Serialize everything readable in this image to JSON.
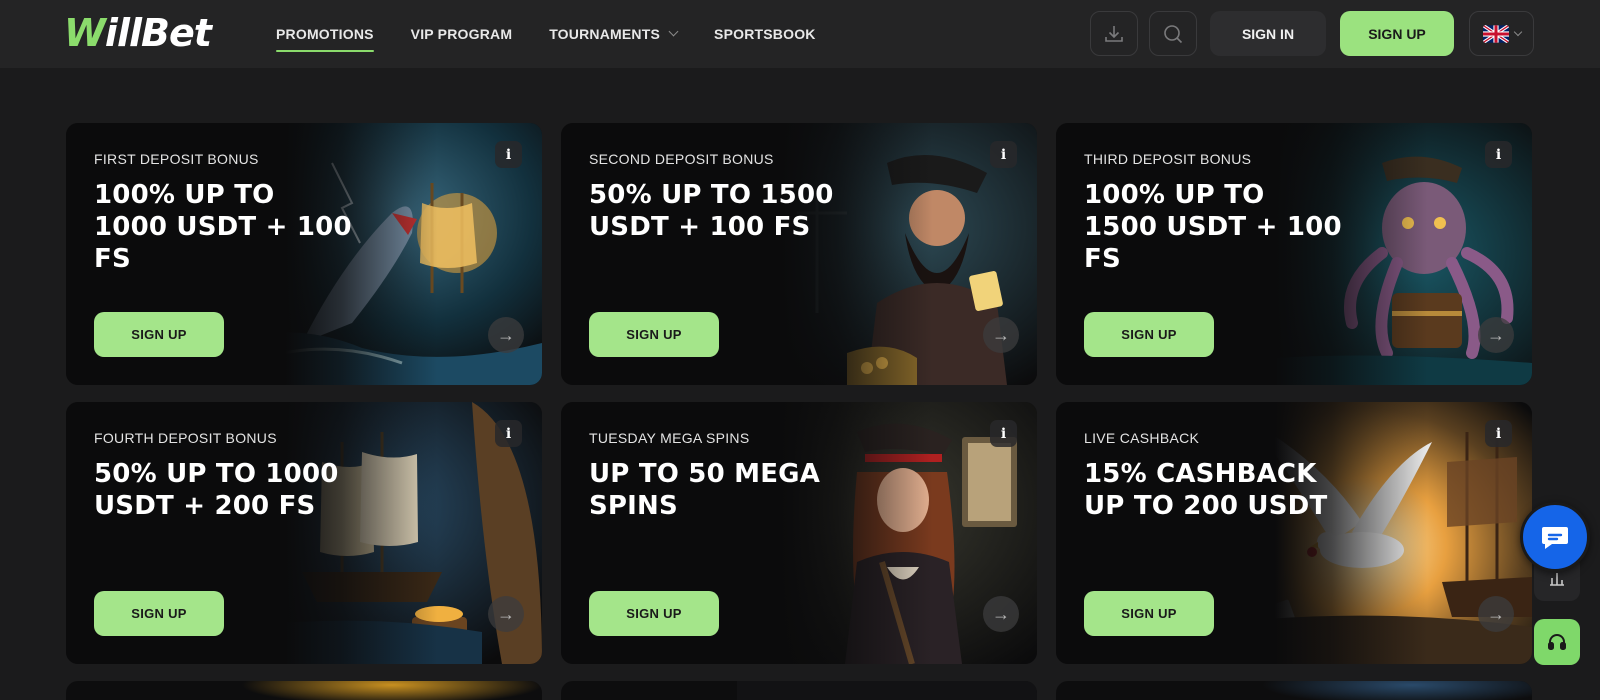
{
  "header": {
    "logo": {
      "w": "W",
      "rest": "illBet"
    },
    "nav": [
      {
        "label": "PROMOTIONS",
        "active": true
      },
      {
        "label": "VIP PROGRAM"
      },
      {
        "label": "TOURNAMENTS",
        "dropdown": true
      },
      {
        "label": "SPORTSBOOK"
      }
    ],
    "download_icon": "download-icon",
    "search_icon": "search-icon",
    "sign_in": "SIGN IN",
    "sign_up": "SIGN UP",
    "language_flag": "uk-flag-icon"
  },
  "colors": {
    "accent": "#9be27f",
    "background": "#1b1b1c",
    "header": "#242425",
    "chat": "#1565e8"
  },
  "promotions": [
    {
      "subtitle": "FIRST DEPOSIT BONUS",
      "title": "100% UP TO 1000 USDT + 100 FS",
      "button": "SIGN UP",
      "art": "shark-ship"
    },
    {
      "subtitle": "SECOND DEPOSIT BONUS",
      "title": "50% UP TO 1500 USDT + 100 FS",
      "button": "SIGN UP",
      "art": "pirate-captain"
    },
    {
      "subtitle": "THIRD DEPOSIT BONUS",
      "title": "100% UP TO 1500 USDT + 100 FS",
      "button": "SIGN UP",
      "art": "octopus-chest"
    },
    {
      "subtitle": "FOURTH DEPOSIT BONUS",
      "title": "50% UP TO 1000 USDT + 200 FS",
      "button": "SIGN UP",
      "art": "ship-cave"
    },
    {
      "subtitle": "TUESDAY MEGA SPINS",
      "title": "UP TO 50 MEGA SPINS",
      "button": "SIGN UP",
      "art": "pirate-woman"
    },
    {
      "subtitle": "LIVE CASHBACK",
      "title": "15% CASHBACK UP TO 200 USDT",
      "button": "SIGN UP",
      "art": "seagull-sunset"
    }
  ],
  "info_glyph": "i",
  "arrow_glyph": "→"
}
